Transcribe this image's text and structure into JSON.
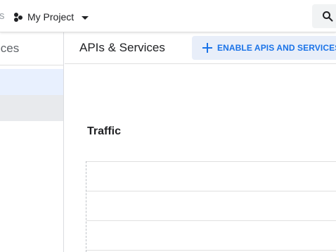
{
  "topbar": {
    "brand_fragment": "s",
    "project_name": "My Project"
  },
  "sidebar": {
    "title_fragment": "ices"
  },
  "page": {
    "title": "APIs & Services",
    "enable_button_label": "ENABLE APIS AND SERVICES"
  },
  "traffic": {
    "title": "Traffic"
  },
  "colors": {
    "accent": "#1a73e8",
    "button_bg": "#e8eef9",
    "active_item_bg": "#e8f0fe",
    "hover_item_bg": "#e8eaed"
  },
  "icons": [
    "project-icon",
    "chevron-down-icon",
    "search-icon",
    "plus-icon"
  ]
}
